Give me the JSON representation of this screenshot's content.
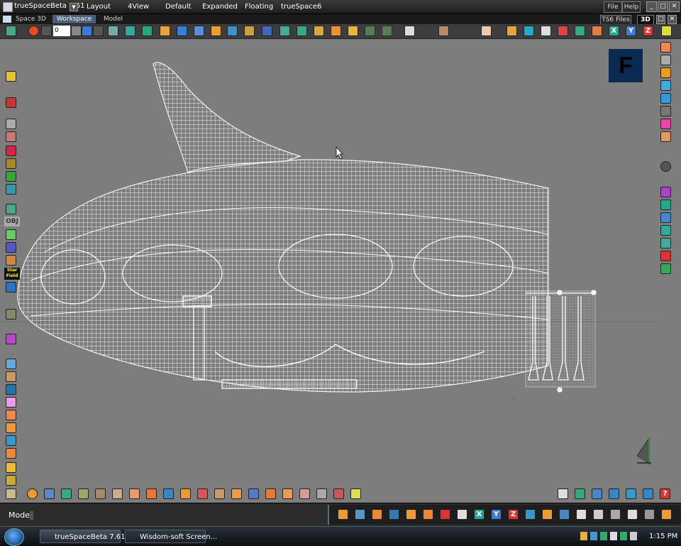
{
  "window": {
    "app_title": "trueSpaceBeta 7.61",
    "menus": [
      "Layout",
      "4View",
      "Default",
      "Expanded",
      "Floating",
      "trueSpace6"
    ],
    "file_label": "File",
    "help_label": "Help"
  },
  "tabs": {
    "space_label": "Space 3D",
    "items": [
      "Workspace",
      "Model"
    ],
    "ts6_files_label": "TS6 Files",
    "mode_3d": "3D"
  },
  "toolbar": {
    "frame_value": "0"
  },
  "viewport": {
    "view_badge": "F",
    "sidebar_labels": {
      "obj": "OBJ",
      "starfield": "Star Field"
    }
  },
  "status": {
    "mode_label": "Model"
  },
  "taskbar": {
    "items": [
      "trueSpaceBeta 7.61",
      "Wisdom-soft Screen..."
    ],
    "clock": "1:15 PM"
  },
  "colors": {
    "viewport_bg": "#7d7d7d",
    "wireframe": "#f2f2f2",
    "view_badge_bg": "#0b2a52"
  }
}
